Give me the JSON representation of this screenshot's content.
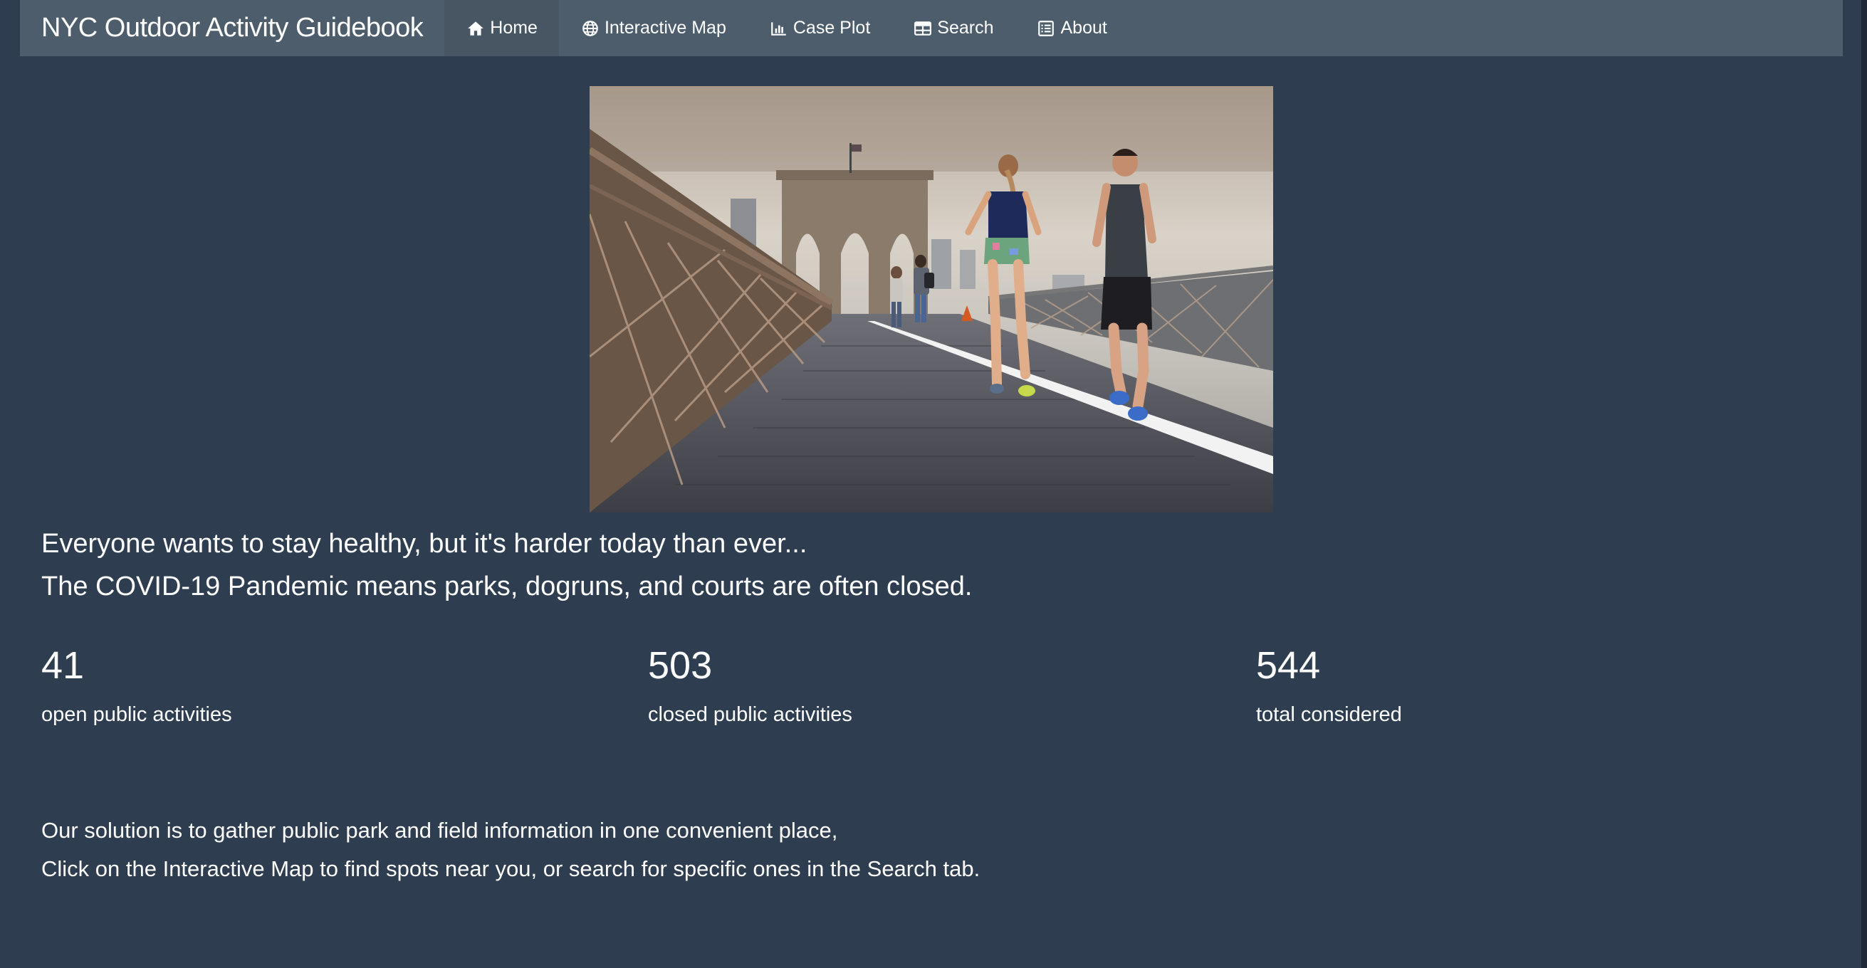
{
  "navbar": {
    "brand": "NYC Outdoor Activity Guidebook",
    "items": [
      {
        "label": "Home",
        "icon": "home-icon",
        "active": true
      },
      {
        "label": "Interactive Map",
        "icon": "globe-icon",
        "active": false
      },
      {
        "label": "Case Plot",
        "icon": "bar-chart-icon",
        "active": false
      },
      {
        "label": "Search",
        "icon": "table-icon",
        "active": false
      },
      {
        "label": "About",
        "icon": "list-icon",
        "active": false
      }
    ]
  },
  "headline": {
    "line1": "Everyone wants to stay healthy, but it's harder today than ever...",
    "line2": "The COVID-19 Pandemic means parks, dogruns, and courts are often closed."
  },
  "stats": [
    {
      "value": "41",
      "label": "open public activities"
    },
    {
      "value": "503",
      "label": "closed public activities"
    },
    {
      "value": "544",
      "label": "total considered"
    }
  ],
  "solution": {
    "line1": "Our solution is to gather public park and field information in one convenient place,",
    "line2": "Click on the Interactive Map to find spots near you, or search for specific ones in the Search tab."
  },
  "colors": {
    "background": "#2e3d50",
    "navbar": "#4e5d6c",
    "navbar_active": "#485563",
    "text": "#ffffff"
  }
}
